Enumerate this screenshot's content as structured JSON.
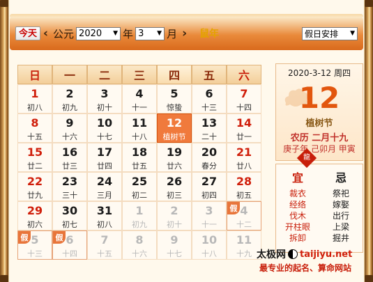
{
  "header": {
    "today_label": "今天",
    "era_label": "公元",
    "year_value": "2020",
    "year_unit": "年",
    "month_value": "3",
    "month_unit": "月",
    "zodiac": "鼠年",
    "holiday_select": "假日安排",
    "prev_icon": "chevron-left-icon",
    "next_icon": "chevron-right-icon"
  },
  "weekdays": [
    "日",
    "一",
    "二",
    "三",
    "四",
    "五",
    "六"
  ],
  "days": [
    {
      "n": "1",
      "l": "初八"
    },
    {
      "n": "2",
      "l": "初九"
    },
    {
      "n": "3",
      "l": "初十"
    },
    {
      "n": "4",
      "l": "十一"
    },
    {
      "n": "5",
      "l": "惊蛰"
    },
    {
      "n": "6",
      "l": "十三"
    },
    {
      "n": "7",
      "l": "十四"
    },
    {
      "n": "8",
      "l": "十五"
    },
    {
      "n": "9",
      "l": "十六"
    },
    {
      "n": "10",
      "l": "十七"
    },
    {
      "n": "11",
      "l": "十八"
    },
    {
      "n": "12",
      "l": "植树节"
    },
    {
      "n": "13",
      "l": "二十"
    },
    {
      "n": "14",
      "l": "廿一"
    },
    {
      "n": "15",
      "l": "廿二"
    },
    {
      "n": "16",
      "l": "廿三"
    },
    {
      "n": "17",
      "l": "廿四"
    },
    {
      "n": "18",
      "l": "廿五"
    },
    {
      "n": "19",
      "l": "廿六"
    },
    {
      "n": "20",
      "l": "春分"
    },
    {
      "n": "21",
      "l": "廿八"
    },
    {
      "n": "22",
      "l": "廿九"
    },
    {
      "n": "23",
      "l": "三十"
    },
    {
      "n": "24",
      "l": "三月"
    },
    {
      "n": "25",
      "l": "初二"
    },
    {
      "n": "26",
      "l": "初三"
    },
    {
      "n": "27",
      "l": "初四"
    },
    {
      "n": "28",
      "l": "初五"
    },
    {
      "n": "29",
      "l": "初六"
    },
    {
      "n": "30",
      "l": "初七"
    },
    {
      "n": "31",
      "l": "初八"
    },
    {
      "n": "1",
      "l": "初九",
      "other": true
    },
    {
      "n": "2",
      "l": "初十",
      "other": true
    },
    {
      "n": "3",
      "l": "十一",
      "other": true
    },
    {
      "n": "4",
      "l": "十二",
      "other": true,
      "holiday": true
    },
    {
      "n": "5",
      "l": "十三",
      "other": true,
      "holiday": true
    },
    {
      "n": "6",
      "l": "十四",
      "other": true,
      "holiday": true
    },
    {
      "n": "7",
      "l": "十五",
      "other": true
    },
    {
      "n": "8",
      "l": "十六",
      "other": true
    },
    {
      "n": "9",
      "l": "十七",
      "other": true
    },
    {
      "n": "10",
      "l": "十八",
      "other": true
    },
    {
      "n": "11",
      "l": "十九",
      "other": true
    }
  ],
  "holiday_mark": "假",
  "selected_index": 11,
  "panel": {
    "date_line": "2020-3-12  周四",
    "big_day": "12",
    "term": "植树节",
    "lunar": "农历  二月十九",
    "ganzhi": "庚子年 己卯月 甲寅",
    "seal_char": "龍"
  },
  "yiji": {
    "yi_title": "宜",
    "ji_title": "忌",
    "yi": [
      "裁衣",
      "经络",
      "伐木",
      "开柱眼",
      "拆卸"
    ],
    "ji": [
      "祭祀",
      "嫁娶",
      "出行",
      "上梁",
      "掘井"
    ]
  },
  "brand": {
    "name": "太极网",
    "url": "taijiyu.net",
    "slogan": "最专业的起名、算命网站"
  },
  "colors": {
    "accent": "#f07a3c",
    "weekend": "#d01e0a",
    "header": "#e98a3b"
  }
}
